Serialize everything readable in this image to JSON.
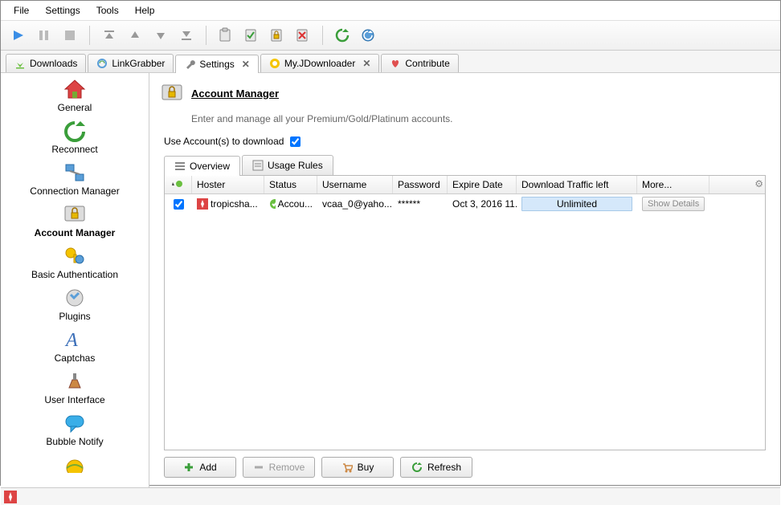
{
  "menu": {
    "file": "File",
    "settings": "Settings",
    "tools": "Tools",
    "help": "Help"
  },
  "tabs": [
    {
      "label": "Downloads"
    },
    {
      "label": "LinkGrabber"
    },
    {
      "label": "Settings"
    },
    {
      "label": "My.JDownloader"
    },
    {
      "label": "Contribute"
    }
  ],
  "sidebar": [
    {
      "label": "General"
    },
    {
      "label": "Reconnect"
    },
    {
      "label": "Connection Manager"
    },
    {
      "label": "Account Manager"
    },
    {
      "label": "Basic Authentication"
    },
    {
      "label": "Plugins"
    },
    {
      "label": "Captchas"
    },
    {
      "label": "User Interface"
    },
    {
      "label": "Bubble Notify"
    }
  ],
  "page": {
    "title": "Account Manager",
    "desc": "Enter and manage all your Premium/Gold/Platinum accounts.",
    "use_accounts": "Use Account(s) to download"
  },
  "subtabs": {
    "overview": "Overview",
    "usage": "Usage Rules"
  },
  "columns": {
    "hoster": "Hoster",
    "status": "Status",
    "username": "Username",
    "password": "Password",
    "expire": "Expire Date",
    "traffic": "Download Traffic left",
    "more": "More..."
  },
  "rows": [
    {
      "hoster": "tropicsha...",
      "status": "Accou...",
      "username": "vcaa_0@yaho...",
      "password": "******",
      "expire": "Oct 3, 2016 11...",
      "traffic": "Unlimited",
      "more": "Show Details"
    }
  ],
  "actions": {
    "add": "Add",
    "remove": "Remove",
    "buy": "Buy",
    "refresh": "Refresh"
  }
}
